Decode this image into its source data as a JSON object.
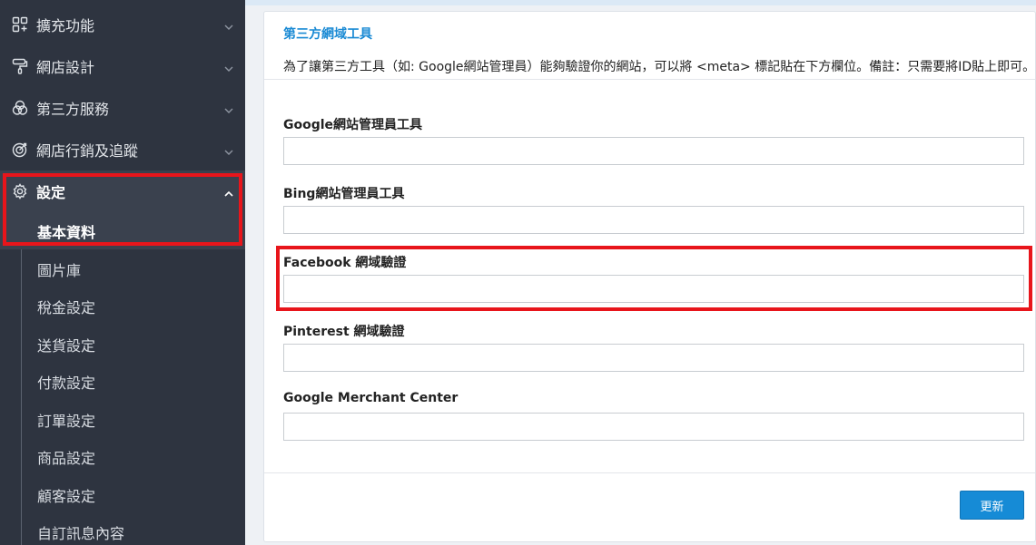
{
  "sidebar": {
    "items": [
      {
        "label": "擴充功能",
        "icon": "apps-icon"
      },
      {
        "label": "網店設計",
        "icon": "paint-roller-icon"
      },
      {
        "label": "第三方服務",
        "icon": "rings-icon"
      },
      {
        "label": "網店行銷及追蹤",
        "icon": "target-icon"
      },
      {
        "label": "設定",
        "icon": "gear-icon"
      }
    ],
    "submenu": [
      {
        "label": "基本資料"
      },
      {
        "label": "圖片庫"
      },
      {
        "label": "稅金設定"
      },
      {
        "label": "送貨設定"
      },
      {
        "label": "付款設定"
      },
      {
        "label": "訂單設定"
      },
      {
        "label": "商品設定"
      },
      {
        "label": "顧客設定"
      },
      {
        "label": "自訂訊息內容"
      }
    ]
  },
  "panel": {
    "title": "第三方網域工具",
    "description": "為了讓第三方工具（如: Google網站管理員）能夠驗證你的網站，可以將 <meta> 標記貼在下方欄位。備註：只需要將ID貼上即可。",
    "fields": [
      {
        "label": "Google網站管理員工具",
        "value": ""
      },
      {
        "label": "Bing網站管理員工具",
        "value": ""
      },
      {
        "label": "Facebook 網域驗證",
        "value": ""
      },
      {
        "label": "Pinterest 網域驗證",
        "value": ""
      },
      {
        "label": "Google Merchant Center",
        "value": ""
      }
    ],
    "update_label": "更新"
  },
  "colors": {
    "sidebar_bg": "#2e3440",
    "accent": "#1a8ad4",
    "highlight": "#e8151b",
    "button": "#168bd6"
  }
}
